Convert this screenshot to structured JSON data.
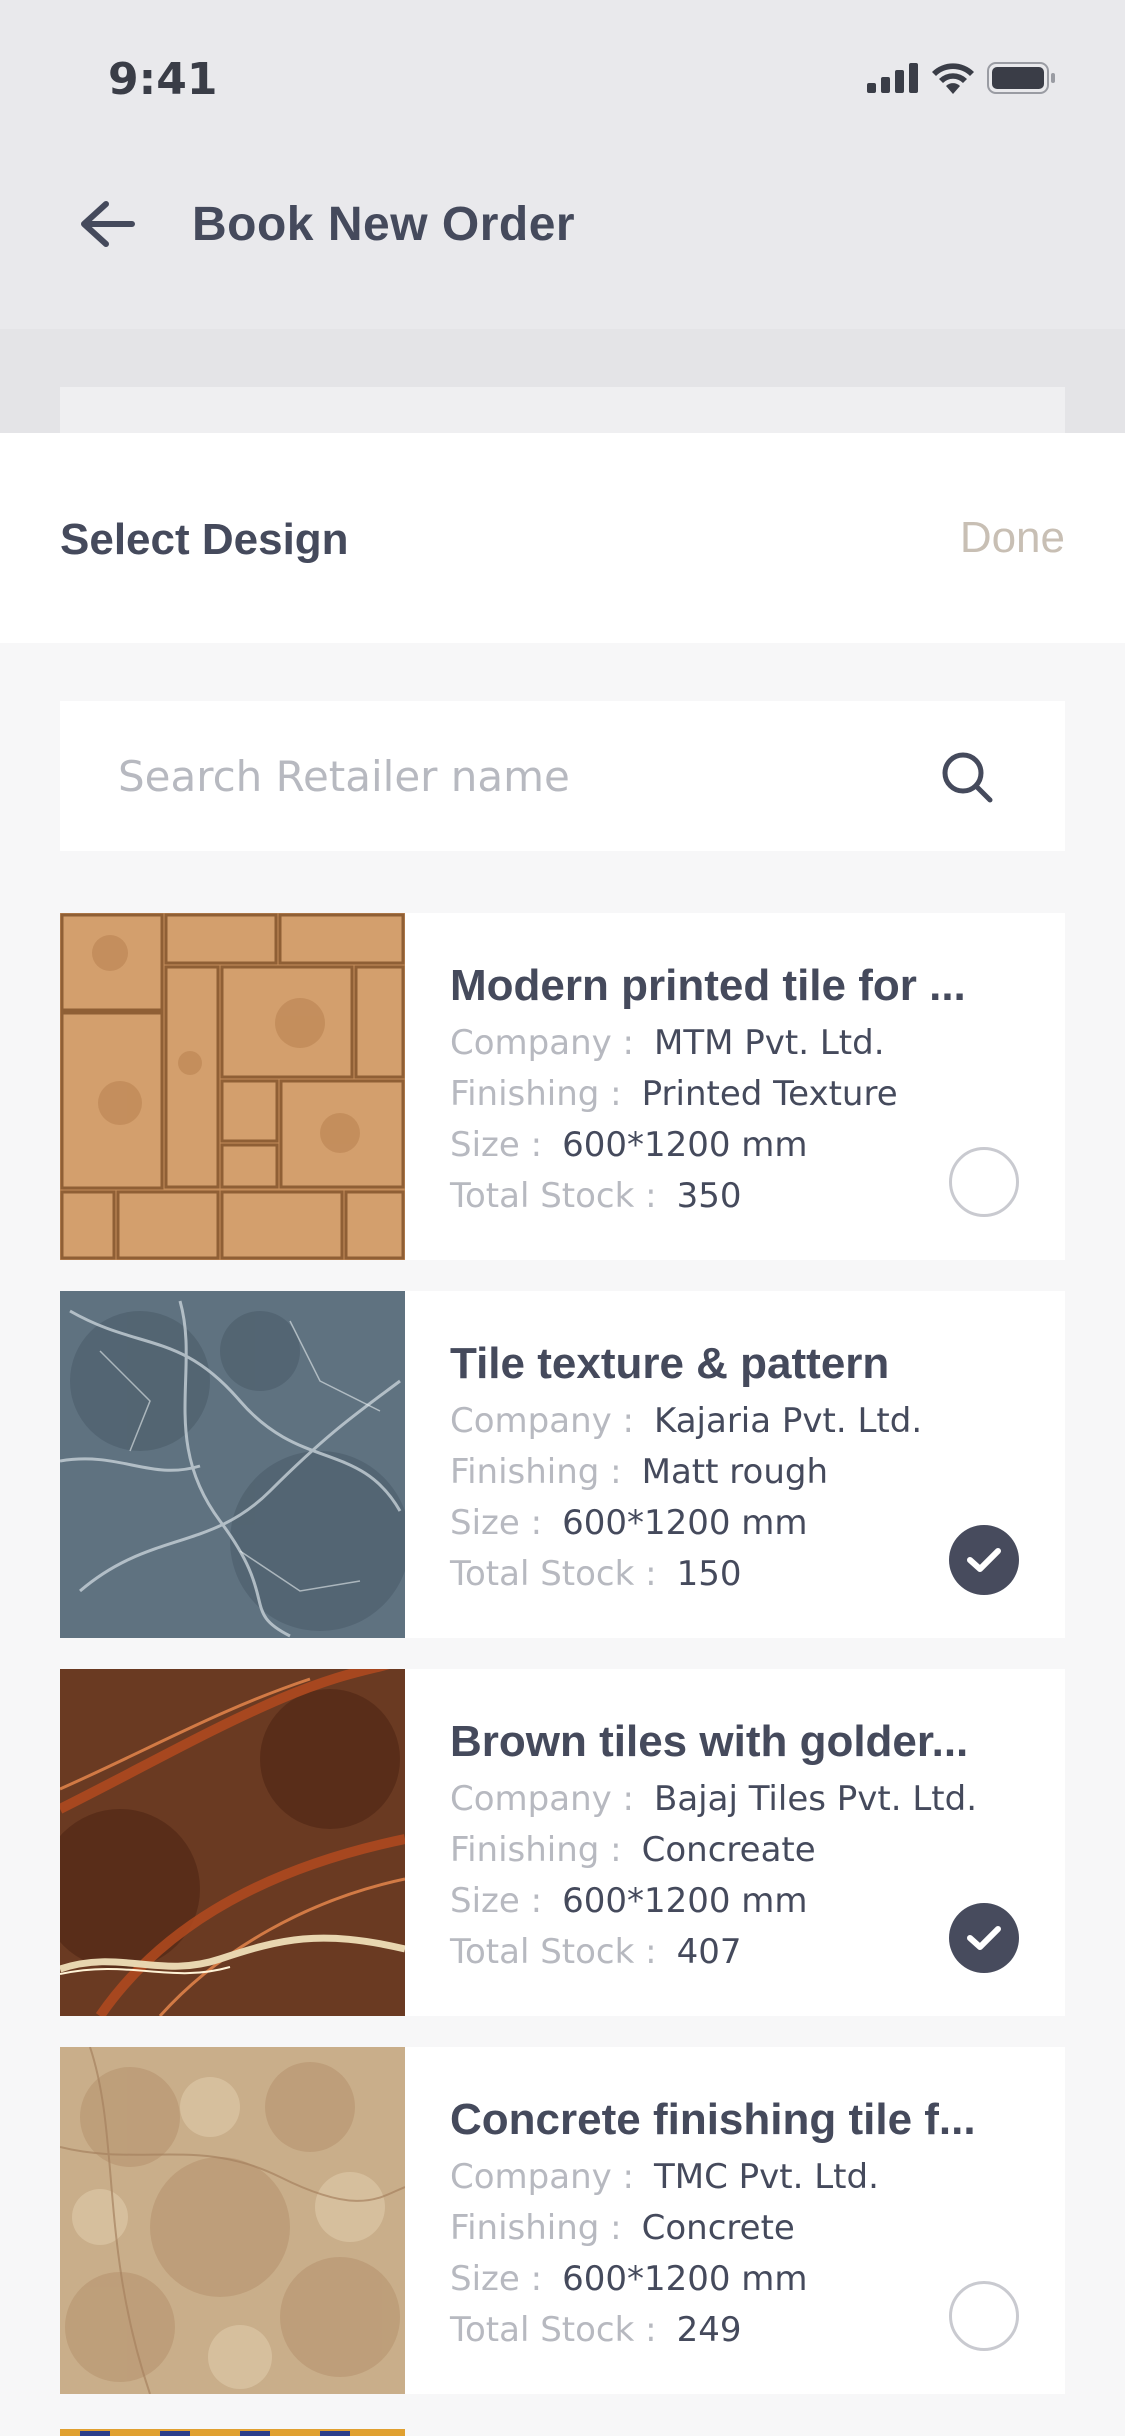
{
  "status_bar": {
    "time": "9:41",
    "icons": [
      "signal-icon",
      "wifi-icon",
      "battery-icon"
    ]
  },
  "header": {
    "title": "Book New Order",
    "back_icon": "arrow-left-icon"
  },
  "sheet": {
    "title": "Select Design",
    "done_label": "Done",
    "search": {
      "placeholder": "Search Retailer name",
      "value": "",
      "icon": "search-icon"
    }
  },
  "labels": {
    "company": "Company :",
    "finishing": "Finishing :",
    "size": "Size :",
    "stock": "Total Stock :"
  },
  "products": [
    {
      "title": "Modern printed tile for ...",
      "company": "MTM Pvt. Ltd.",
      "finishing": "Printed Texture",
      "size": "600*1200 mm",
      "stock": "350",
      "selected": false
    },
    {
      "title": "Tile texture & pattern",
      "company": "Kajaria Pvt. Ltd.",
      "finishing": "Matt rough",
      "size": "600*1200 mm",
      "stock": "150",
      "selected": true
    },
    {
      "title": "Brown tiles with golder...",
      "company": "Bajaj Tiles Pvt. Ltd.",
      "finishing": "Concreate",
      "size": "600*1200 mm",
      "stock": "407",
      "selected": true
    },
    {
      "title": "Concrete finishing tile f...",
      "company": "TMC Pvt. Ltd.",
      "finishing": "Concrete",
      "size": "600*1200 mm",
      "stock": "249",
      "selected": false
    }
  ],
  "colors": {
    "primary_text": "#454a5c",
    "muted_text": "#b7b9c0",
    "done": "#c8bfb4",
    "check_on": "#474b5d"
  }
}
